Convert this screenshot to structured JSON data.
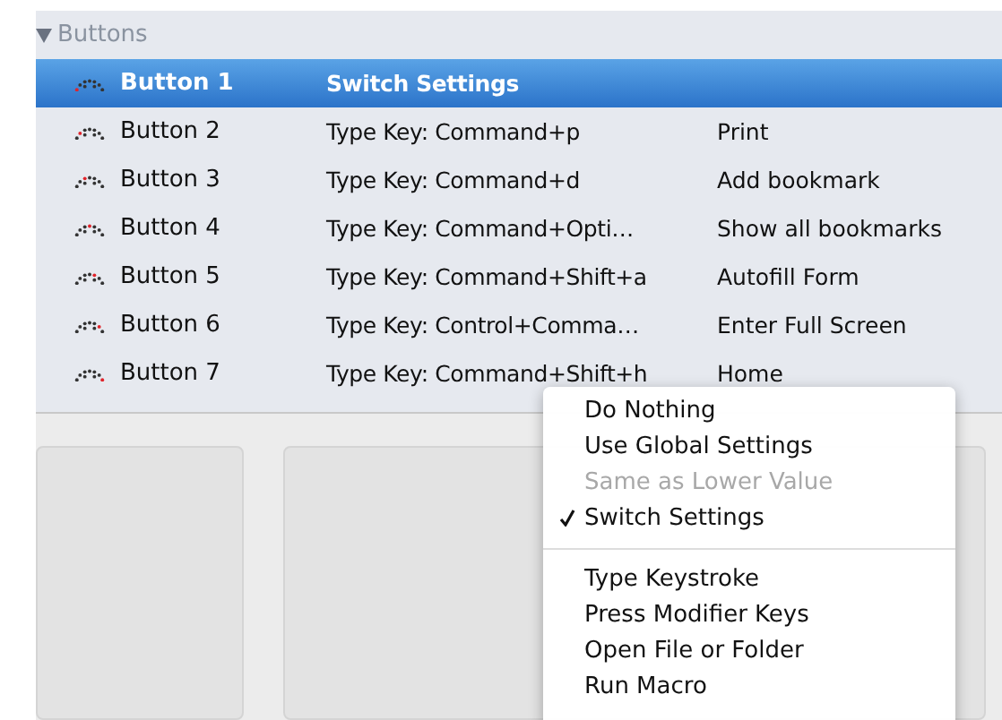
{
  "section": {
    "title": "Buttons",
    "expanded": true
  },
  "rows": [
    {
      "name": "Button 1",
      "action": "Switch Settings",
      "selected": true
    },
    {
      "name": "Button 2",
      "action": "Type Key: Command+p",
      "description": "Print",
      "selected": false
    },
    {
      "name": "Button 3",
      "action": "Type Key: Command+d",
      "description": "Add bookmark",
      "selected": false
    },
    {
      "name": "Button 4",
      "action": "Type Key: Command+Opti…",
      "description": "Show all bookmarks",
      "selected": false
    },
    {
      "name": "Button 5",
      "action": "Type Key: Command+Shift+a",
      "description": "Autofill Form",
      "selected": false
    },
    {
      "name": "Button 6",
      "action": "Type Key: Control+Comma…",
      "description": "Enter Full Screen",
      "selected": false
    },
    {
      "name": "Button 7",
      "action": "Type Key: Command+Shift+h",
      "description": "Home",
      "selected": false
    }
  ],
  "menu": [
    {
      "kind": "item",
      "label": "Do Nothing",
      "disabled": false,
      "checked": false
    },
    {
      "kind": "item",
      "label": "Use Global Settings",
      "disabled": false,
      "checked": false
    },
    {
      "kind": "item",
      "label": "Same as Lower Value",
      "disabled": true,
      "checked": false
    },
    {
      "kind": "item",
      "label": "Switch Settings",
      "disabled": false,
      "checked": true
    },
    {
      "kind": "separator"
    },
    {
      "kind": "item",
      "label": "Type Keystroke",
      "disabled": false,
      "checked": false
    },
    {
      "kind": "item",
      "label": "Press Modifier Keys",
      "disabled": false,
      "checked": false
    },
    {
      "kind": "item",
      "label": "Open File or Folder",
      "disabled": false,
      "checked": false
    },
    {
      "kind": "item",
      "label": "Run Macro",
      "disabled": false,
      "checked": false
    }
  ]
}
